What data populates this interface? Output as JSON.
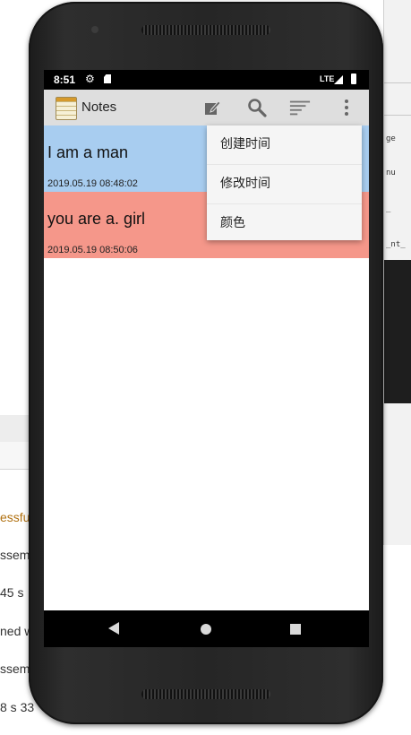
{
  "ide": {
    "right_fragments": [
      "ge",
      "nu",
      "_",
      "_nt_"
    ],
    "left_lines": [
      "essfu",
      "ssem",
      "45 s",
      "ned w",
      "ssem",
      "8 s 33"
    ]
  },
  "status": {
    "time": "8:51",
    "network": "LTE"
  },
  "app": {
    "title": "Notes"
  },
  "notes": [
    {
      "title": "I am a man",
      "date": "2019.05.19 08:48:02",
      "color": "#a8cdf0"
    },
    {
      "title": "you are a. girl",
      "date": "2019.05.19 08:50:06",
      "color": "#f5978a"
    }
  ],
  "menu": {
    "items": [
      "创建时间",
      "修改时间",
      "颜色"
    ]
  },
  "icons": {
    "edit": "edit-note-icon",
    "search": "search-icon",
    "sort": "sort-icon",
    "overflow": "more-vert-icon"
  }
}
